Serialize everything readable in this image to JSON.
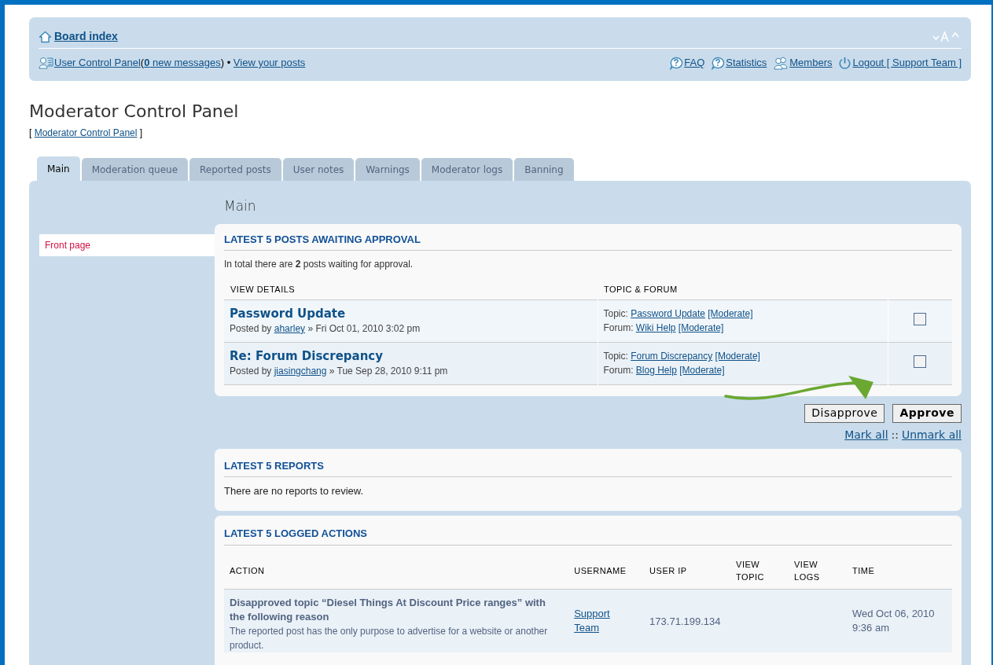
{
  "header": {
    "board_index": "Board index",
    "user_menu": {
      "ucp": "User Control Panel",
      "open": "(",
      "message_count": "0",
      "messages": "new messages",
      "close": ")",
      "bullet": "•",
      "view_posts": "View your posts"
    },
    "links": [
      {
        "kind": "help",
        "label": "FAQ"
      },
      {
        "kind": "help",
        "label": "Statistics"
      },
      {
        "kind": "members",
        "label": "Members"
      },
      {
        "kind": "logout",
        "label": "Logout [ Support Team ]"
      }
    ]
  },
  "page_title": "Moderator Control Panel",
  "breadcrumb_open": "[",
  "breadcrumb": "Moderator Control Panel",
  "breadcrumb_close": "]",
  "tabs": [
    {
      "label": "Main",
      "selected": true
    },
    {
      "label": "Moderation queue",
      "selected": false
    },
    {
      "label": "Reported posts",
      "selected": false
    },
    {
      "label": "User notes",
      "selected": false
    },
    {
      "label": "Warnings",
      "selected": false
    },
    {
      "label": "Moderator logs",
      "selected": false
    },
    {
      "label": "Banning",
      "selected": false
    }
  ],
  "sidebar": {
    "items": [
      {
        "label": "Front page",
        "selected": true
      }
    ]
  },
  "section_title": "Main",
  "queue": {
    "title": "LATEST 5 POSTS AWAITING APPROVAL",
    "summary": "In total there are **2** posts waiting for approval.",
    "columns": [
      "VIEW DETAILS",
      "TOPIC & FORUM"
    ],
    "rows": [
      {
        "title": "Password Update",
        "by": "Posted by",
        "author": "aharley",
        "date": "» Fri Oct 01, 2010 3:02 pm",
        "topic_label": "Topic:",
        "topic": "Password Update",
        "topic_moderate": "[Moderate]",
        "forum_label": "Forum:",
        "forum": "Wiki Help",
        "forum_moderate": "[Moderate]",
        "checked": false
      },
      {
        "title": "Re: Forum Discrepancy",
        "by": "Posted by",
        "author": "jiasingchang",
        "date": "» Tue Sep 28, 2010 9:11 pm",
        "topic_label": "Topic:",
        "topic": "Forum Discrepancy",
        "topic_moderate": "[Moderate]",
        "forum_label": "Forum:",
        "forum": "Blog Help",
        "forum_moderate": "[Moderate]",
        "checked": false
      }
    ],
    "buttons": [
      {
        "label": "Disapprove",
        "primary": false
      },
      {
        "label": "Approve",
        "primary": true
      }
    ],
    "mark_all": "Mark all",
    "mark_sep": "::",
    "unmark_all": "Unmark all"
  },
  "reports": {
    "title": "LATEST 5 REPORTS",
    "message": "There are no reports to review."
  },
  "logs": {
    "title": "LATEST 5 LOGGED ACTIONS",
    "columns": [
      "ACTION",
      "USERNAME",
      "USER IP",
      "VIEW TOPIC",
      "VIEW LOGS",
      "TIME"
    ],
    "rows": [
      {
        "action": "Disapproved topic “Diesel Things At Discount Price ranges” with the following reason",
        "reason": "The reported post has the only purpose to advertise for a website or another product.",
        "username": "Support Team",
        "ip": "173.71.199.134",
        "time": "Wed Oct 06, 2010 9:36 am"
      }
    ]
  }
}
